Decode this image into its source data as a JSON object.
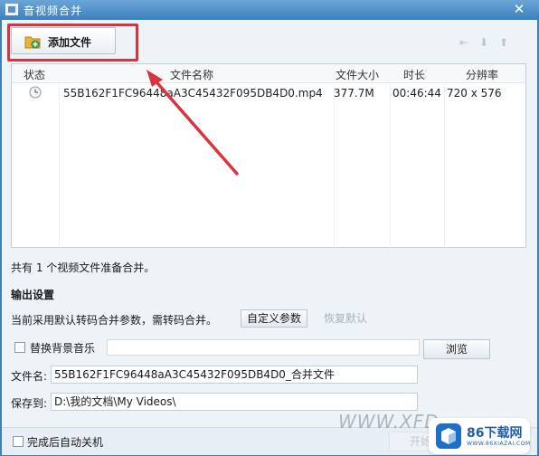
{
  "window": {
    "title": "音视频合并",
    "close_glyph": "✕"
  },
  "toolbar": {
    "add_file_label": "添加文件",
    "icons": [
      "move-top-icon",
      "move-down-icon",
      "move-up-icon"
    ]
  },
  "list": {
    "columns": [
      "状态",
      "文件名称",
      "文件大小",
      "时长",
      "分辨率"
    ],
    "rows": [
      {
        "status_icon": "clock-icon",
        "name": "55B162F1FC96448aA3C45432F095DB4D0.mp4",
        "size": "377.7M",
        "duration": "00:46:44",
        "resolution": "720 x 576"
      }
    ]
  },
  "summary": "共有 1 个视频文件准备合并。",
  "output": {
    "section_title": "输出设置",
    "param_text": "当前采用默认转码合并参数，需转码合并。",
    "custom_button": "自定义参数",
    "default_button": "恢复默认",
    "bg_music_label": "替换背景音乐",
    "bg_music_checked": false,
    "browse_button": "浏览",
    "filename_label": "文件名:",
    "filename_value": "55B162F1FC96448aA3C45432F095DB4D0_合并文件",
    "saveto_label": "保存到:",
    "saveto_value": "D:\\我的文档\\My Videos\\"
  },
  "footer": {
    "shutdown_label": "完成后自动关机",
    "shutdown_checked": false,
    "start_button": "开始"
  },
  "watermark": {
    "text": "WWW.XFD",
    "brand": "86下载网",
    "domain": "WWW.86XIAZAI.COM"
  },
  "colors": {
    "highlight": "#d9333f",
    "titlebar": "#3d80c0"
  }
}
